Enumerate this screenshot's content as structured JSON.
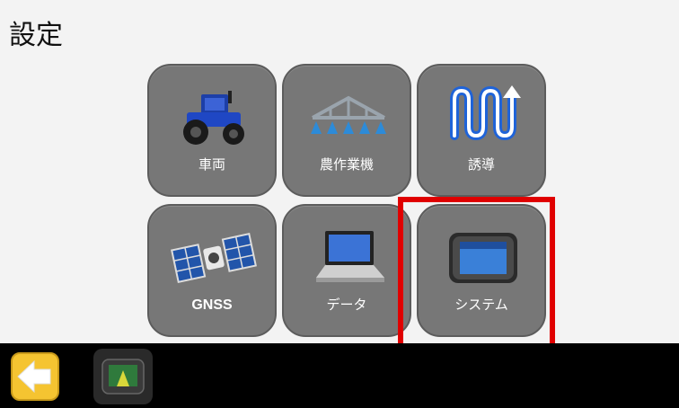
{
  "page": {
    "title": "設定"
  },
  "tiles": [
    {
      "label": "車両",
      "icon": "tractor-icon"
    },
    {
      "label": "農作業機",
      "icon": "implement-boom-icon"
    },
    {
      "label": "誘導",
      "icon": "guidance-pattern-icon"
    },
    {
      "label": "GNSS",
      "icon": "satellite-icon"
    },
    {
      "label": "データ",
      "icon": "laptop-icon"
    },
    {
      "label": "システム",
      "icon": "display-console-icon"
    }
  ],
  "selected_tile": "システム",
  "bottom_bar": {
    "back_icon": "back-arrow-icon",
    "display_icon": "display-console-icon"
  },
  "colors": {
    "tile_background": "#777777",
    "highlight": "#e00000",
    "bottom_bar": "#000000",
    "back_button": "#f5c431"
  }
}
